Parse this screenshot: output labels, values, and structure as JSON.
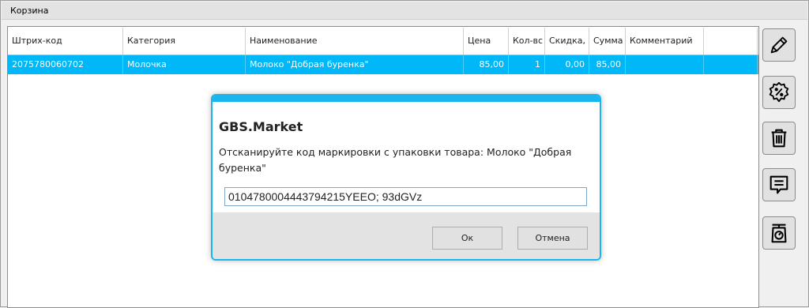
{
  "panel": {
    "title": "Корзина"
  },
  "grid": {
    "columns": [
      "Штрих-код",
      "Категория",
      "Наименование",
      "Цена",
      "Кол-вс",
      "Скидка,",
      "Сумма",
      "Комментарий",
      ""
    ],
    "rows": [
      [
        "2075780060702",
        "Молочка",
        "Молоко \"Добрая буренка\"",
        "85,00",
        "1",
        "0,00",
        "85,00",
        "",
        ""
      ]
    ]
  },
  "toolbar": {
    "buttons": [
      {
        "name": "edit",
        "icon": "pencil-icon"
      },
      {
        "name": "discount",
        "icon": "percent-badge-icon"
      },
      {
        "name": "delete",
        "icon": "trash-icon"
      },
      {
        "name": "comment",
        "icon": "comment-icon"
      },
      {
        "name": "weight",
        "icon": "scale-icon"
      }
    ]
  },
  "dialog": {
    "title": "GBS.Market",
    "message": "Отсканируйте код маркировки с упаковки товара: Молоко \"Добрая буренка\"",
    "input_value": "0104780004443794215YEEO; 93dGVz",
    "ok_label": "Ок",
    "cancel_label": "Отмена"
  },
  "colors": {
    "selection": "#00b7f7",
    "dialog_accent": "#19b5ee"
  }
}
